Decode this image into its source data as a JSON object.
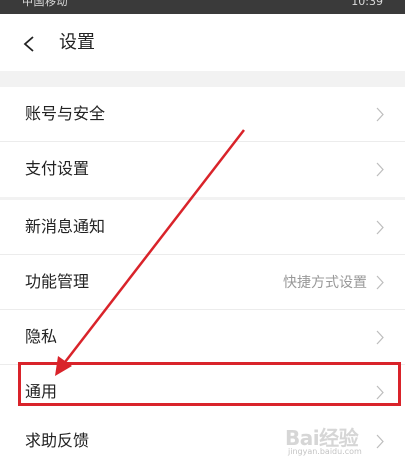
{
  "status_bar": {
    "left_text": "中国移动",
    "right_text": "10:39"
  },
  "header": {
    "title": "设置"
  },
  "groups": [
    {
      "items": [
        {
          "label": "账号与安全",
          "value": ""
        },
        {
          "label": "支付设置",
          "value": ""
        }
      ]
    },
    {
      "items": [
        {
          "label": "新消息通知",
          "value": ""
        },
        {
          "label": "功能管理",
          "value": "快捷方式设置"
        },
        {
          "label": "隐私",
          "value": ""
        },
        {
          "label": "通用",
          "value": ""
        }
      ]
    },
    {
      "items": [
        {
          "label": "求助反馈",
          "value": ""
        }
      ]
    }
  ],
  "annotation": {
    "highlighted_item": "通用",
    "highlight_color": "#d9232a"
  },
  "watermark": {
    "text": "Bai经验",
    "subtext": "jingyan.baidu.com"
  },
  "colors": {
    "background": "#f2f2f2",
    "row_background": "#ffffff",
    "chevron": "#bdbdbd",
    "annotation_red": "#d9232a"
  }
}
